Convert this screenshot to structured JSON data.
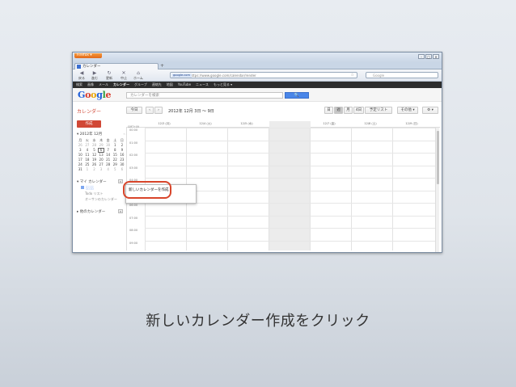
{
  "browser": {
    "menu_button": "Firefox ▾",
    "window_controls": [
      "–",
      "□",
      "✕"
    ],
    "tab_title": "カレンダー",
    "new_tab": "+",
    "nav_buttons": [
      {
        "icon": "back-icon",
        "glyph": "◀",
        "label": "戻る"
      },
      {
        "icon": "forward-icon",
        "glyph": "▶",
        "label": "進む"
      },
      {
        "icon": "reload-icon",
        "glyph": "↻",
        "label": "更新"
      },
      {
        "icon": "stop-icon",
        "glyph": "✕",
        "label": "中止"
      },
      {
        "icon": "home-icon",
        "glyph": "⌂",
        "label": "ホーム"
      }
    ],
    "url_identity": "google.com",
    "url": "https://www.google.com/calendar/render",
    "search_placeholder": "Google"
  },
  "gbar": [
    "検索",
    "画像",
    "メール",
    "カレンダー",
    "グループ",
    "連絡先",
    "地図",
    "YouTube",
    "ニュース",
    "もっと見る ▾"
  ],
  "gbar_active_index": 3,
  "header": {
    "logo": [
      "G",
      "o",
      "o",
      "g",
      "l",
      "e"
    ],
    "search_placeholder": "カレンダーを検索",
    "search_button": "🔍"
  },
  "app": {
    "title": "カレンダー",
    "create_button": "作成",
    "today_button": "今日",
    "prev": "‹",
    "next": "›",
    "date_range": "2012年 12月 3日 ～ 9日",
    "views": [
      "日",
      "週",
      "月",
      "4日",
      "予定リスト"
    ],
    "active_view": "週",
    "more_button": "その他 ▾",
    "settings_button": "⚙ ▾"
  },
  "mini_calendar": {
    "title": "▾ 2012年 12月",
    "nav": "‹ ›",
    "weekdays": [
      "月",
      "火",
      "水",
      "木",
      "金",
      "土",
      "日"
    ],
    "weeks": [
      [
        "26",
        "27",
        "28",
        "29",
        "30",
        "1",
        "2"
      ],
      [
        "3",
        "4",
        "5",
        "6",
        "7",
        "8",
        "9"
      ],
      [
        "10",
        "11",
        "12",
        "13",
        "14",
        "15",
        "16"
      ],
      [
        "17",
        "18",
        "19",
        "20",
        "21",
        "22",
        "23"
      ],
      [
        "24",
        "25",
        "26",
        "27",
        "28",
        "29",
        "30"
      ],
      [
        "31",
        "1",
        "2",
        "3",
        "4",
        "5",
        "6"
      ]
    ]
  },
  "sidebar": {
    "my_calendars": "▾ マイ カレンダー",
    "items": [
      "░░░",
      "Todo リスト",
      "オーサンのカレンダー"
    ],
    "other_calendars": "▸ 他のカレンダー"
  },
  "days": [
    "12/3 (月)",
    "12/4 (火)",
    "12/5 (水)",
    "12/6 (木)",
    "12/7 (金)",
    "12/8 (土)",
    "12/9 (日)"
  ],
  "timezone": "GMT+09",
  "hours": [
    "00:00",
    "01:00",
    "02:00",
    "03:00",
    "04:00",
    "05:00",
    "06:00",
    "07:00",
    "08:00",
    "09:00"
  ],
  "popup_item": "新しいカレンダーを作成",
  "caption": "新しいカレンダー作成をクリック",
  "colors": {
    "accent": "#d14836",
    "ring": "#d8452a",
    "blue": "#4a86e8"
  }
}
